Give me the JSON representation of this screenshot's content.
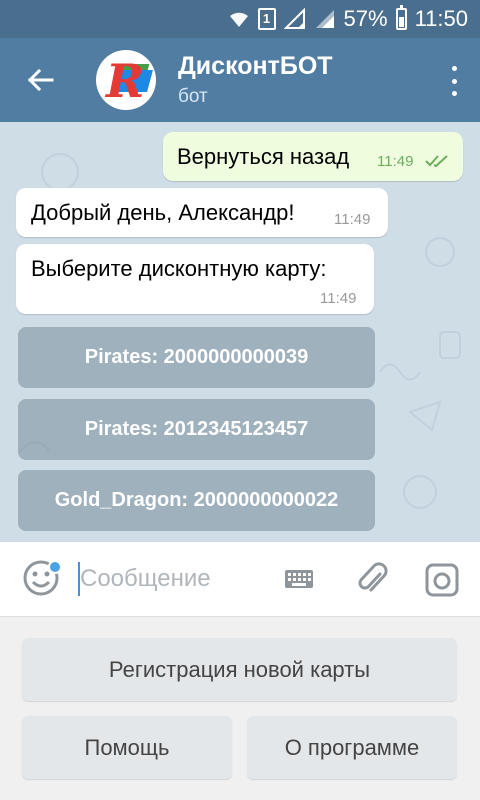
{
  "status_bar": {
    "sim_slot": "1",
    "battery_percent": "57%",
    "time": "11:50"
  },
  "header": {
    "title": "ДисконтБОТ",
    "subtitle": "бот",
    "avatar_icon": "restart-logo-icon"
  },
  "messages": [
    {
      "direction": "outgoing",
      "text": "Вернуться назад",
      "time": "11:49",
      "status": "read"
    },
    {
      "direction": "incoming",
      "text": "Добрый день, Александр!",
      "time": "11:49"
    },
    {
      "direction": "incoming",
      "text": "Выберите дисконтную карту:",
      "time": "11:49"
    }
  ],
  "inline_buttons": [
    {
      "label": "Pirates: 2000000000039"
    },
    {
      "label": "Pirates: 2012345123457"
    },
    {
      "label": "Gold_Dragon: 2000000000022"
    }
  ],
  "input": {
    "placeholder": "Сообщение",
    "value": ""
  },
  "reply_keyboard": [
    {
      "label": "Регистрация новой карты"
    },
    {
      "label": "Помощь"
    },
    {
      "label": "О программе"
    }
  ],
  "colors": {
    "status_bar": "#4a6e8e",
    "header": "#527da3",
    "chat_background": "#cfdde7",
    "outgoing_bubble": "#effdde",
    "incoming_bubble": "#ffffff",
    "read_check": "#6cae5d",
    "accent_dot": "#4aa3e6"
  }
}
